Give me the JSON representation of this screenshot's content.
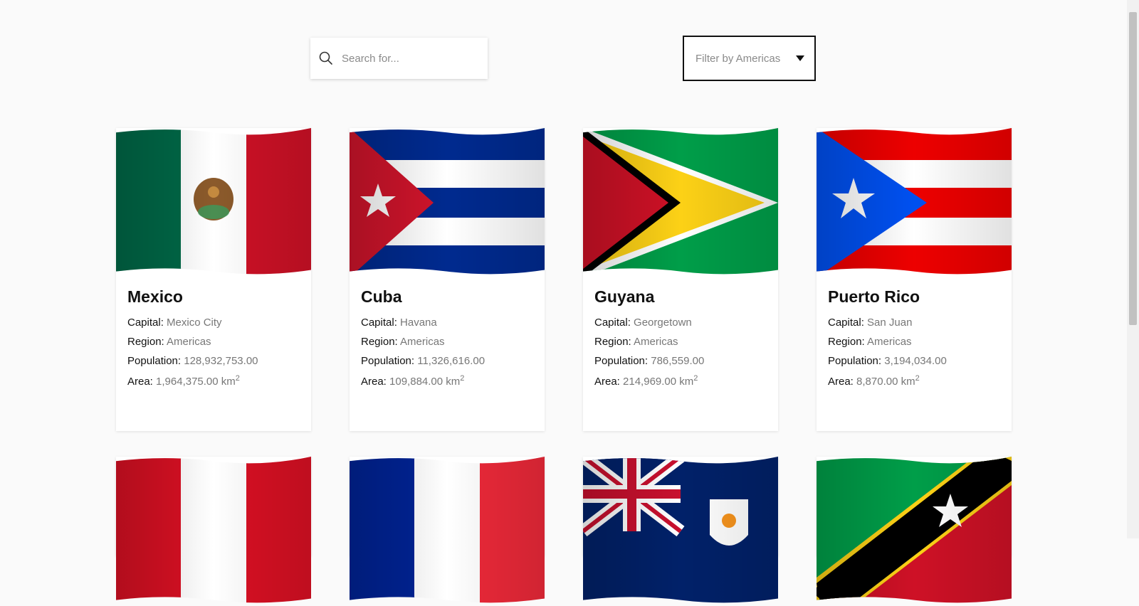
{
  "search": {
    "placeholder": "Search for..."
  },
  "filter": {
    "label": "Filter by Americas"
  },
  "labels": {
    "capital": "Capital:",
    "region": "Region:",
    "population": "Population:",
    "area": "Area:",
    "area_unit": "km",
    "area_exp": "2"
  },
  "countries": [
    {
      "name": "Mexico",
      "capital": "Mexico City",
      "region": "Americas",
      "population": "128,932,753.00",
      "area": "1,964,375.00"
    },
    {
      "name": "Cuba",
      "capital": "Havana",
      "region": "Americas",
      "population": "11,326,616.00",
      "area": "109,884.00"
    },
    {
      "name": "Guyana",
      "capital": "Georgetown",
      "region": "Americas",
      "population": "786,559.00",
      "area": "214,969.00"
    },
    {
      "name": "Puerto Rico",
      "capital": "San Juan",
      "region": "Americas",
      "population": "3,194,034.00",
      "area": "8,870.00"
    }
  ],
  "flags": [
    "mexico-flag",
    "cuba-flag",
    "guyana-flag",
    "puerto-rico-flag",
    "peru-flag",
    "france-flag",
    "anguilla-flag",
    "saint-kitts-and-nevis-flag"
  ],
  "colors": {
    "background": "#fafafa",
    "card": "#ffffff",
    "value_text": "#777777"
  }
}
